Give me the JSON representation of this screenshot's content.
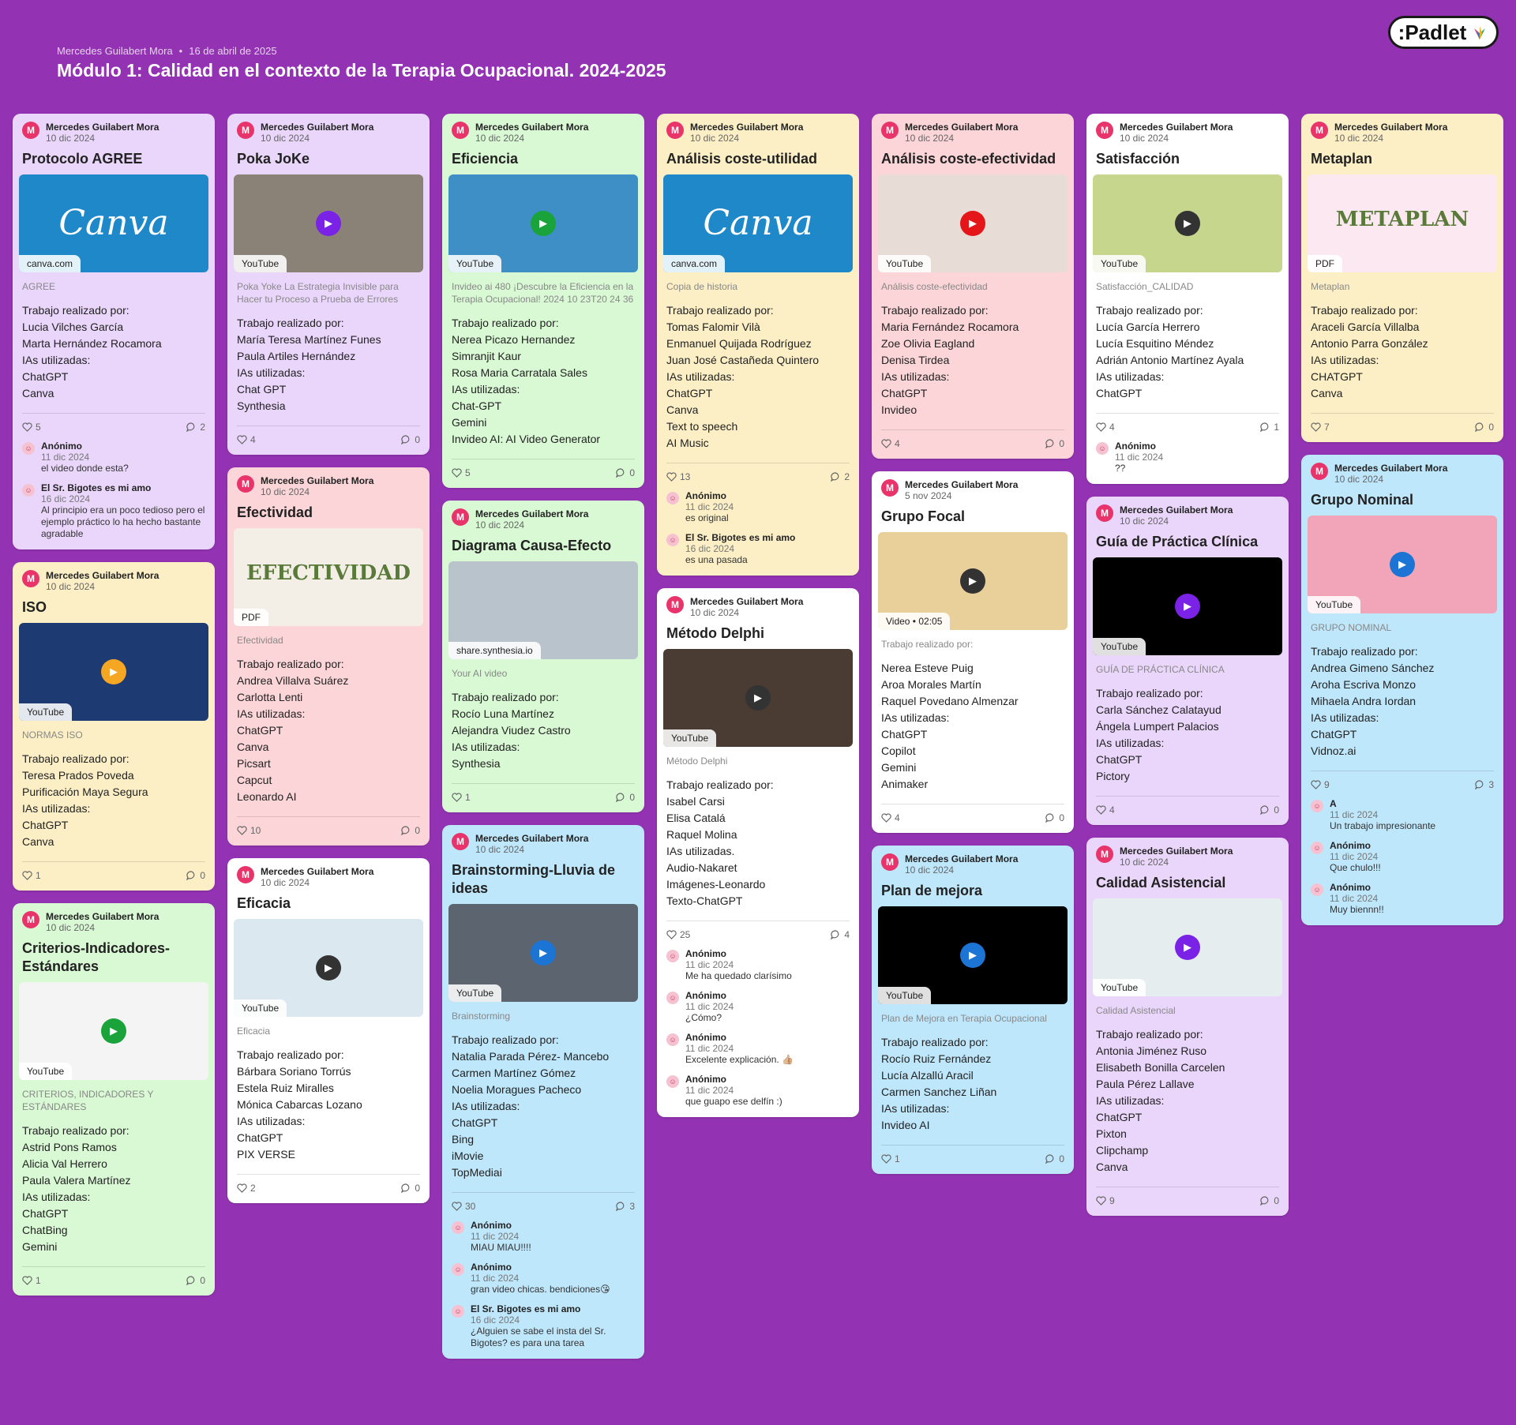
{
  "board": {
    "author": "Mercedes Guilabert Mora",
    "date": "16 de abril de 2025",
    "title": "Módulo 1: Calidad en el contexto de la Terapia Ocupacional. 2024-2025",
    "logo_text": ":Padlet"
  },
  "columns": [
    {
      "cards": [
        {
          "color": "purple",
          "author": "Mercedes Guilabert Mora",
          "date": "10 dic 2024",
          "title": "Protocolo AGREE",
          "thumb": {
            "kind": "canva",
            "source": "canva.com",
            "bg": "#1e88c9",
            "text": "Canva"
          },
          "desc": "AGREE",
          "body": [
            "Trabajo realizado por:",
            "Lucia Vilches García",
            "Marta Hernández Rocamora",
            "IAs utilizadas:",
            "ChatGPT",
            "Canva"
          ],
          "likes": "5",
          "comments": "2",
          "thread": [
            {
              "name": "Anónimo",
              "date": "11 dic 2024",
              "text": "el video donde esta?"
            },
            {
              "name": "El Sr. Bigotes es mi amo",
              "date": "16 dic 2024",
              "text": "Al principio era un poco tedioso pero el ejemplo práctico lo ha hecho bastante agradable"
            }
          ]
        },
        {
          "color": "yellow",
          "author": "Mercedes Guilabert Mora",
          "date": "10 dic 2024",
          "title": "ISO",
          "thumb": {
            "kind": "video",
            "source": "YouTube",
            "bg": "#1d3a73",
            "play": "#f5a623"
          },
          "desc": "NORMAS ISO",
          "body": [
            "Trabajo realizado por:",
            "Teresa Prados Poveda",
            "Purificación Maya Segura",
            "IAs utilizadas:",
            "ChatGPT",
            "Canva"
          ],
          "likes": "1",
          "comments": "0",
          "thread": []
        },
        {
          "color": "green",
          "author": "Mercedes Guilabert Mora",
          "date": "10 dic 2024",
          "title": "Criterios-Indicadores-Estándares",
          "thumb": {
            "kind": "video",
            "source": "YouTube",
            "bg": "#f4f4f4",
            "play": "#1aa33a"
          },
          "desc": "CRITERIOS, INDICADORES Y ESTÁNDARES",
          "body": [
            "Trabajo realizado por:",
            "Astrid Pons Ramos",
            "Alicia Val Herrero",
            "Paula Valera Martínez",
            "IAs utilizadas:",
            "ChatGPT",
            "ChatBing",
            "Gemini"
          ],
          "likes": "1",
          "comments": "0",
          "thread": []
        }
      ]
    },
    {
      "cards": [
        {
          "color": "purple",
          "author": "Mercedes Guilabert Mora",
          "date": "10 dic 2024",
          "title": "Poka JoKe",
          "thumb": {
            "kind": "video",
            "source": "YouTube",
            "bg": "#8a8276",
            "play": "#7a22e6"
          },
          "desc": "Poka Yoke  La Estrategia Invisible para Hacer tu Proceso a Prueba de Errores",
          "body": [
            "Trabajo realizado por:",
            "María Teresa Martínez Funes",
            "Paula Artiles Hernández",
            "IAs utilizadas:",
            "Chat GPT",
            "Synthesia"
          ],
          "likes": "4",
          "comments": "0",
          "thread": []
        },
        {
          "color": "pink",
          "author": "Mercedes Guilabert Mora",
          "date": "10 dic 2024",
          "title": "Efectividad",
          "thumb": {
            "kind": "pdf",
            "source": "PDF",
            "bg": "#f3efe6",
            "text": "EFECTIVIDAD"
          },
          "desc": "Efectividad",
          "body": [
            "Trabajo realizado por:",
            "Andrea Villalva Suárez",
            "Carlotta Lenti",
            "IAs utilizadas:",
            "ChatGPT",
            "Canva",
            "Picsart",
            "Capcut",
            "Leonardo AI"
          ],
          "likes": "10",
          "comments": "0",
          "thread": []
        },
        {
          "color": "white",
          "author": "Mercedes Guilabert Mora",
          "date": "10 dic 2024",
          "title": "Eficacia",
          "thumb": {
            "kind": "video",
            "source": "YouTube",
            "bg": "#dbe8ef",
            "play": "#333333"
          },
          "desc": "Eficacia",
          "body": [
            "Trabajo realizado por:",
            "Bárbara Soriano Torrús",
            "Estela Ruiz Miralles",
            "Mónica Cabarcas Lozano",
            "IAs utilizadas:",
            "ChatGPT",
            "PIX VERSE"
          ],
          "likes": "2",
          "comments": "0",
          "thread": []
        }
      ]
    },
    {
      "cards": [
        {
          "color": "green",
          "author": "Mercedes Guilabert Mora",
          "date": "10 dic 2024",
          "title": "Eficiencia",
          "thumb": {
            "kind": "video",
            "source": "YouTube",
            "bg": "#3f8fc7",
            "play": "#1aa33a"
          },
          "desc": "Invideo ai 480 ¡Descubre la Eficiencia en la Terapia Ocupacional! 2024 10 23T20 24 36",
          "body": [
            "Trabajo realizado por:",
            "Nerea Picazo Hernandez",
            "Simranjit Kaur",
            "Rosa Maria Carratala Sales",
            "IAs utilizadas:",
            "Chat-GPT",
            "Gemini",
            "Invideo AI: AI Video Generator"
          ],
          "likes": "5",
          "comments": "0",
          "thread": []
        },
        {
          "color": "green",
          "author": "Mercedes Guilabert Mora",
          "date": "10 dic 2024",
          "title": "Diagrama Causa-Efecto",
          "thumb": {
            "kind": "image",
            "source": "share.synthesia.io",
            "bg": "#b9c3cc"
          },
          "desc": "Your AI video",
          "body": [
            "Trabajo realizado por:",
            "Rocío Luna Martínez",
            "Alejandra Viudez Castro",
            "IAs utilizadas:",
            "Synthesia"
          ],
          "likes": "1",
          "comments": "0",
          "thread": []
        },
        {
          "color": "blue",
          "author": "Mercedes Guilabert Mora",
          "date": "10 dic 2024",
          "title": "Brainstorming-Lluvia de ideas",
          "thumb": {
            "kind": "video",
            "source": "YouTube",
            "bg": "#5c6470",
            "play": "#1c74d4"
          },
          "desc": "Brainstorming",
          "body": [
            "Trabajo realizado por:",
            "Natalia Parada Pérez- Mancebo",
            "Carmen Martínez Gómez",
            "Noelia Moragues Pacheco",
            "IAs utilizadas:",
            "ChatGPT",
            "Bing",
            "iMovie",
            "TopMediai"
          ],
          "likes": "30",
          "comments": "3",
          "thread": [
            {
              "name": "Anónimo",
              "date": "11 dic 2024",
              "text": "MIAU MIAU!!!!"
            },
            {
              "name": "Anónimo",
              "date": "11 dic 2024",
              "text": "gran video chicas. bendiciones😘"
            },
            {
              "name": "El Sr. Bigotes es mi amo",
              "date": "16 dic 2024",
              "text": "¿Alguien se sabe el insta del Sr. Bigotes? es para una tarea"
            }
          ]
        }
      ]
    },
    {
      "cards": [
        {
          "color": "yellow",
          "author": "Mercedes Guilabert Mora",
          "date": "10 dic 2024",
          "title": "Análisis coste-utilidad",
          "thumb": {
            "kind": "canva",
            "source": "canva.com",
            "bg": "#1e88c9",
            "text": "Canva"
          },
          "desc": "Copia de historia",
          "body": [
            "Trabajo realizado por:",
            "Tomas Falomir Vilà",
            "Enmanuel Quijada Rodríguez",
            "Juan José Castañeda Quintero",
            "IAs utilizadas:",
            "ChatGPT",
            "Canva",
            "Text to speech",
            "AI Music"
          ],
          "likes": "13",
          "comments": "2",
          "thread": [
            {
              "name": "Anónimo",
              "date": "11 dic 2024",
              "text": "es original"
            },
            {
              "name": "El Sr. Bigotes es mi amo",
              "date": "16 dic 2024",
              "text": "es una pasada"
            }
          ]
        },
        {
          "color": "white",
          "author": "Mercedes Guilabert Mora",
          "date": "10 dic 2024",
          "title": "Método Delphi",
          "thumb": {
            "kind": "video",
            "source": "YouTube",
            "bg": "#4a3b33",
            "play": "#333333"
          },
          "desc": "Método Delphi",
          "body": [
            "Trabajo realizado por:",
            "Isabel Carsi",
            "Elisa Catalá",
            "Raquel Molina",
            "IAs utilizadas.",
            "Audio-Nakaret",
            "Imágenes-Leonardo",
            "Texto-ChatGPT"
          ],
          "likes": "25",
          "comments": "4",
          "thread": [
            {
              "name": "Anónimo",
              "date": "11 dic 2024",
              "text": "Me ha quedado clarísimo"
            },
            {
              "name": "Anónimo",
              "date": "11 dic 2024",
              "text": "¿Cómo?"
            },
            {
              "name": "Anónimo",
              "date": "11 dic 2024",
              "text": "Excelente explicación. 👍🏼"
            },
            {
              "name": "Anónimo",
              "date": "11 dic 2024",
              "text": "que guapo ese delfín :)"
            }
          ]
        }
      ]
    },
    {
      "cards": [
        {
          "color": "pink",
          "author": "Mercedes Guilabert Mora",
          "date": "10 dic 2024",
          "title": "Análisis coste-efectividad",
          "thumb": {
            "kind": "video",
            "source": "YouTube",
            "bg": "#e8ddd6",
            "play": "#e4161a"
          },
          "desc": "Análisis coste-efectividad",
          "body": [
            "Trabajo realizado por:",
            "Maria Fernández Rocamora",
            "Zoe Olivia Eagland",
            "Denisa Tirdea",
            "IAs utilizadas:",
            "ChatGPT",
            "Invideo"
          ],
          "likes": "4",
          "comments": "0",
          "thread": []
        },
        {
          "color": "white",
          "author": "Mercedes Guilabert Mora",
          "date": "5 nov 2024",
          "title": "Grupo Focal",
          "thumb": {
            "kind": "video",
            "source": "Video • 02:05",
            "bg": "#e9cf9a",
            "play": "#333333"
          },
          "desc": "Trabajo realizado por:",
          "body": [
            "Nerea Esteve Puig",
            "Aroa Morales Martín",
            "Raquel Povedano Almenzar",
            "IAs utilizadas:",
            "ChatGPT",
            "Copilot",
            "Gemini",
            "Animaker"
          ],
          "likes": "4",
          "comments": "0",
          "thread": []
        },
        {
          "color": "blue",
          "author": "Mercedes Guilabert Mora",
          "date": "10 dic 2024",
          "title": "Plan de mejora",
          "thumb": {
            "kind": "video",
            "source": "YouTube",
            "bg": "#000000",
            "play": "#1c74d4"
          },
          "desc": "Plan de Mejora en Terapia Ocupacional",
          "body": [
            "Trabajo realizado por:",
            "Rocío Ruiz Fernández",
            "Lucía Alzallú Aracil",
            "Carmen Sanchez Liñan",
            "IAs utilizadas:",
            "Invideo AI"
          ],
          "likes": "1",
          "comments": "0",
          "thread": []
        }
      ]
    },
    {
      "cards": [
        {
          "color": "white",
          "author": "Mercedes Guilabert Mora",
          "date": "10 dic 2024",
          "title": "Satisfacción",
          "thumb": {
            "kind": "video",
            "source": "YouTube",
            "bg": "#c6d68c",
            "play": "#333333"
          },
          "desc": "Satisfacción_CALIDAD",
          "body": [
            "Trabajo realizado por:",
            "Lucía García Herrero",
            "Lucía Esquitino Méndez",
            "Adrián Antonio Martínez Ayala",
            "IAs utilizadas:",
            "ChatGPT"
          ],
          "likes": "4",
          "comments": "1",
          "thread": [
            {
              "name": "Anónimo",
              "date": "11 dic 2024",
              "text": "??"
            }
          ]
        },
        {
          "color": "purple",
          "author": "Mercedes Guilabert Mora",
          "date": "10 dic 2024",
          "title": "Guía de Práctica Clínica",
          "thumb": {
            "kind": "video",
            "source": "YouTube",
            "bg": "#000000",
            "play": "#7a22e6"
          },
          "desc": "GUÍA DE PRÁCTICA CLÍNICA",
          "body": [
            "Trabajo realizado por:",
            "Carla Sánchez Calatayud",
            "Ángela Lumpert Palacios",
            "IAs utilizadas:",
            "ChatGPT",
            "Pictory"
          ],
          "likes": "4",
          "comments": "0",
          "thread": []
        },
        {
          "color": "purple",
          "author": "Mercedes Guilabert Mora",
          "date": "10 dic 2024",
          "title": "Calidad Asistencial",
          "thumb": {
            "kind": "video",
            "source": "YouTube",
            "bg": "#e6edef",
            "play": "#7a22e6"
          },
          "desc": "Calidad Asistencial",
          "body": [
            "Trabajo realizado por:",
            "Antonia Jiménez Ruso",
            "Elisabeth Bonilla Carcelen",
            "Paula Pérez Lallave",
            "IAs utilizadas:",
            "ChatGPT",
            "Pixton",
            "Clipchamp",
            "Canva"
          ],
          "likes": "9",
          "comments": "0",
          "thread": []
        }
      ]
    },
    {
      "cards": [
        {
          "color": "yellow",
          "author": "Mercedes Guilabert Mora",
          "date": "10 dic 2024",
          "title": "Metaplan",
          "thumb": {
            "kind": "pdf",
            "source": "PDF",
            "bg": "#fbe8f1",
            "text": "METAPLAN"
          },
          "desc": "Metaplan",
          "body": [
            "Trabajo realizado por:",
            "Araceli García Villalba",
            "Antonio Parra González",
            "IAs utilizadas:",
            "CHATGPT",
            "Canva"
          ],
          "likes": "7",
          "comments": "0",
          "thread": []
        },
        {
          "color": "blue",
          "author": "Mercedes Guilabert Mora",
          "date": "10 dic 2024",
          "title": "Grupo Nominal",
          "thumb": {
            "kind": "video",
            "source": "YouTube",
            "bg": "#f2a5b8",
            "play": "#1c74d4"
          },
          "desc": "GRUPO NOMINAL",
          "body": [
            "Trabajo realizado por:",
            "Andrea Gimeno Sánchez",
            "Aroha Escriva Monzo",
            "Mihaela Andra Iordan",
            "IAs utilizadas:",
            "ChatGPT",
            "Vidnoz.ai"
          ],
          "likes": "9",
          "comments": "3",
          "thread": [
            {
              "name": "A",
              "date": "11 dic 2024",
              "text": "Un trabajo  impresionante"
            },
            {
              "name": "Anónimo",
              "date": "11 dic 2024",
              "text": "Que chulo!!!"
            },
            {
              "name": "Anónimo",
              "date": "11 dic 2024",
              "text": "Muy biennn!!"
            }
          ]
        }
      ]
    }
  ],
  "icons": {
    "like": "heart-outline-icon",
    "comment": "speech-bubble-icon",
    "play": "play-icon"
  },
  "colors": {
    "background": "#9333b3",
    "purple": "#ead6fb",
    "pink": "#fbd5d8",
    "green": "#d9f8d4",
    "yellow": "#fcefc6",
    "white": "#ffffff",
    "blue": "#bfe7fb"
  }
}
